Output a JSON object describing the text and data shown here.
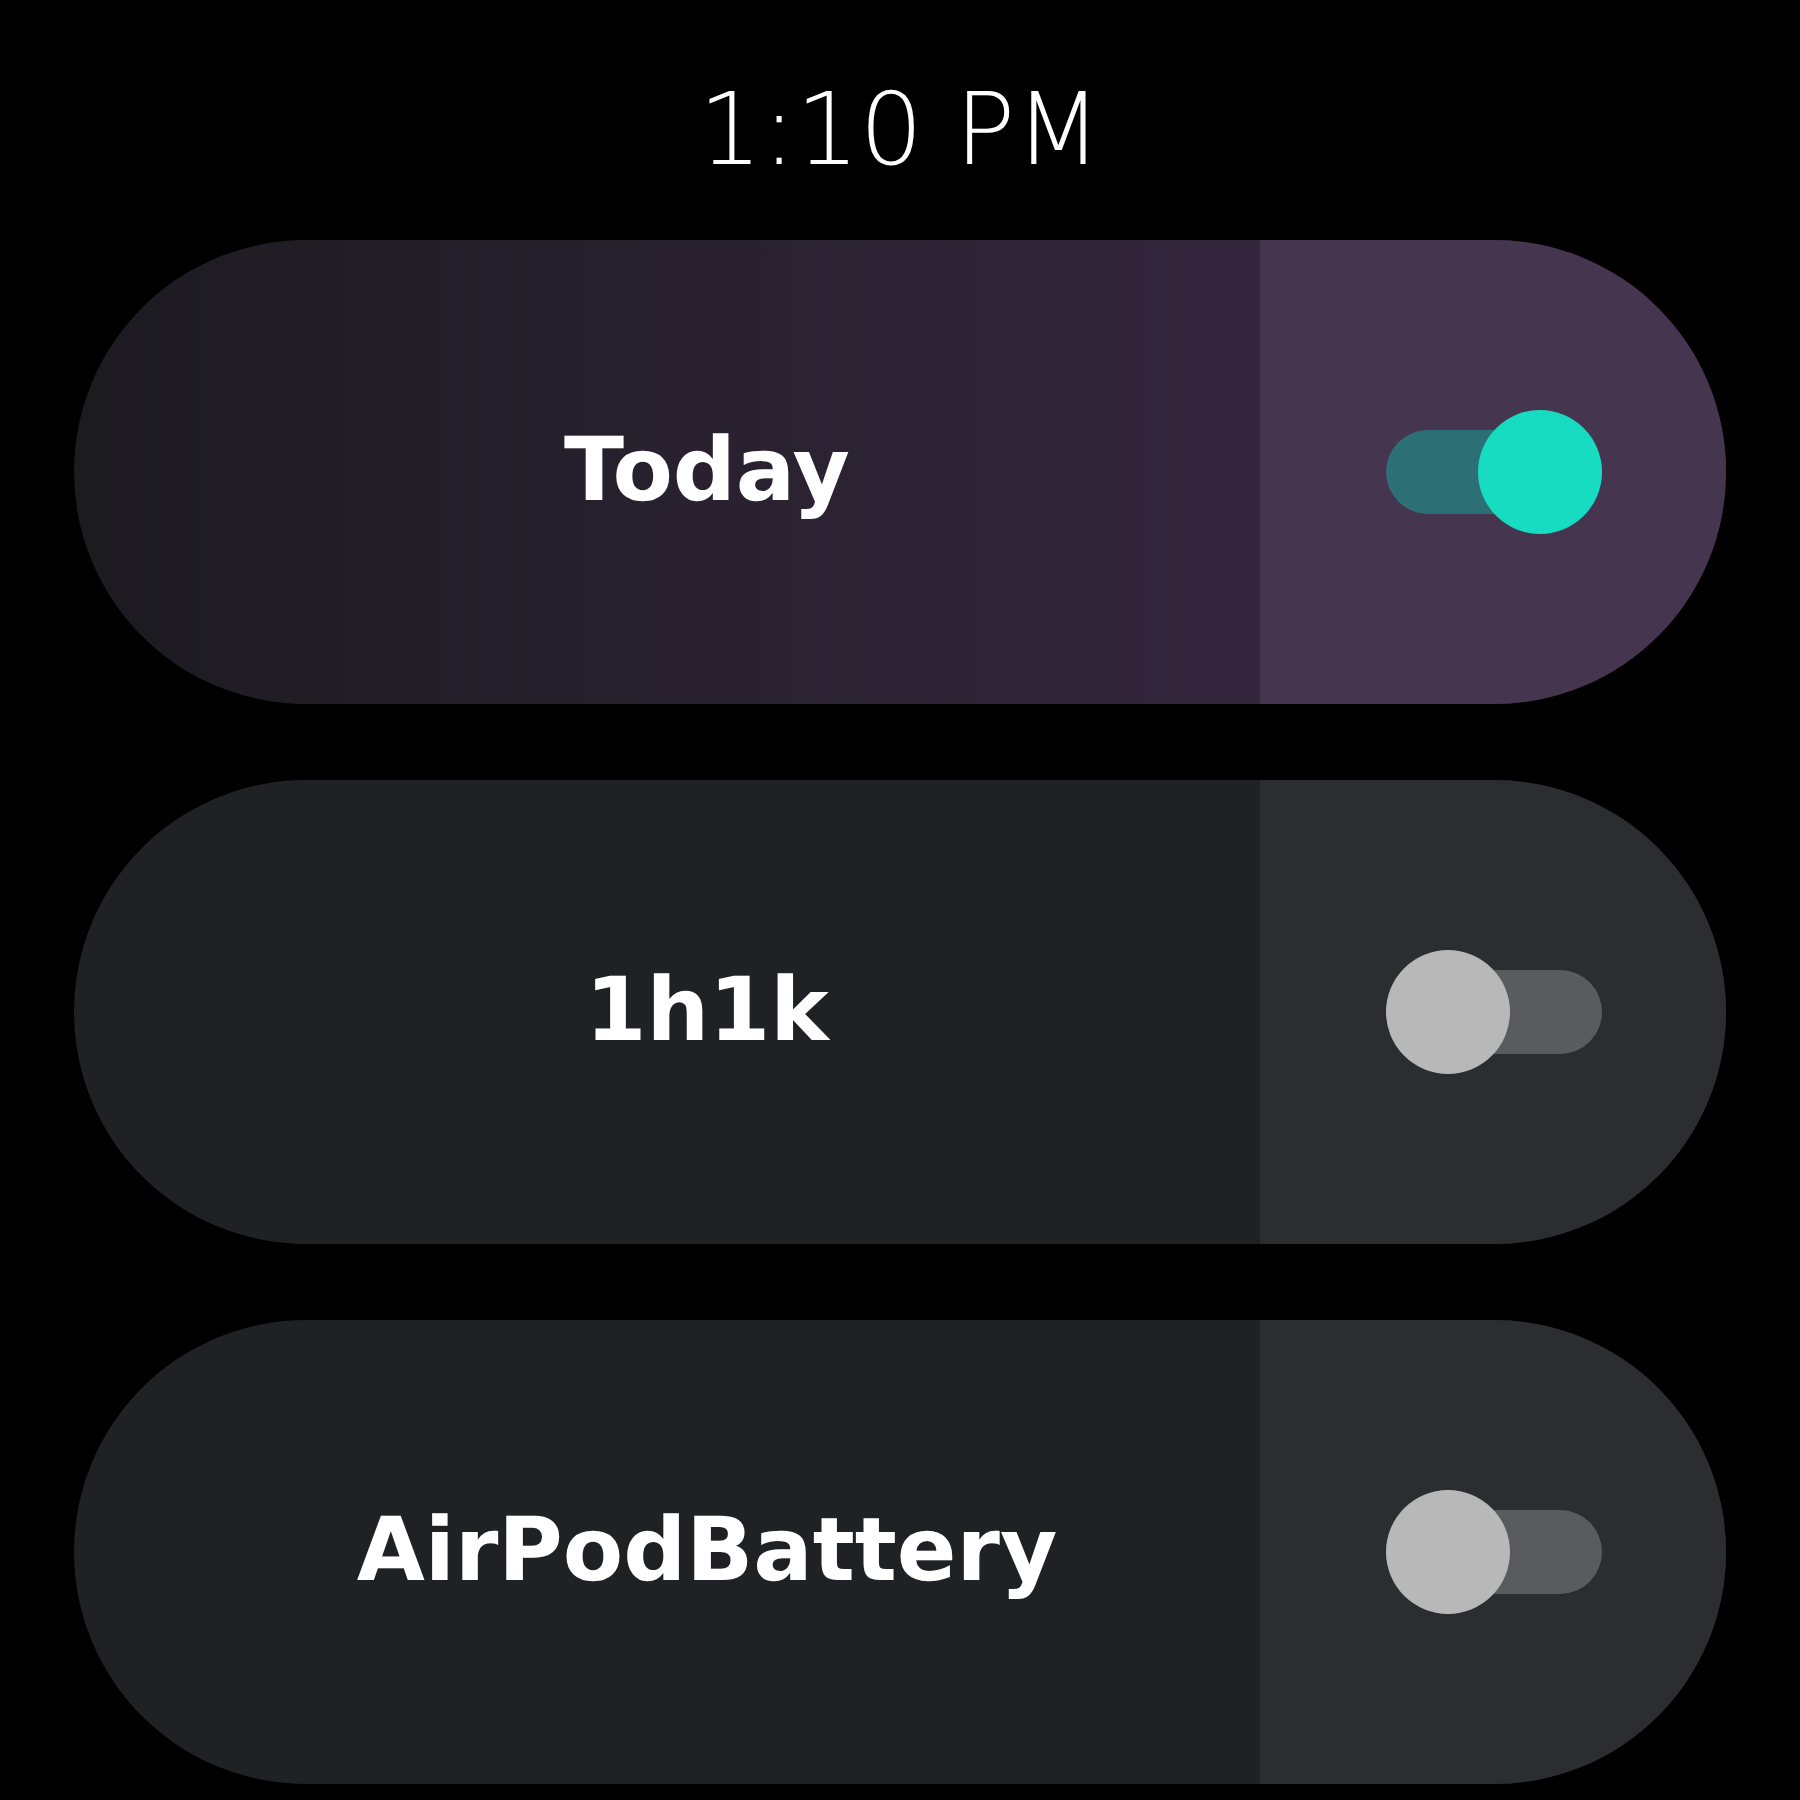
{
  "status_bar": {
    "time": "1:10 PM"
  },
  "tiles": [
    {
      "label": "Today",
      "on": true
    },
    {
      "label": "1h1k",
      "on": false
    },
    {
      "label": "AirPodBattery",
      "on": false
    }
  ]
}
